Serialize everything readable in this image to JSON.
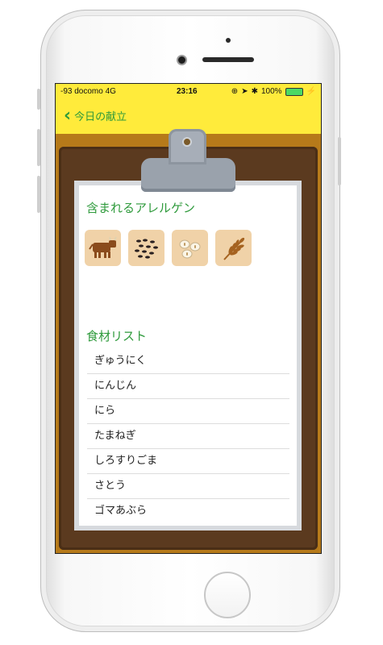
{
  "statusbar": {
    "carrier": "-93 docomo  4G",
    "time": "23:16",
    "battery": "100%"
  },
  "navbar": {
    "back_label": "今日の献立"
  },
  "allergens": {
    "title": "含まれるアレルゲン",
    "items": [
      {
        "icon": "cow-icon"
      },
      {
        "icon": "sesame-icon"
      },
      {
        "icon": "soybean-icon"
      },
      {
        "icon": "wheat-icon"
      }
    ]
  },
  "ingredients": {
    "title": "食材リスト",
    "items": [
      "ぎゅうにく",
      "にんじん",
      "にら",
      "たまねぎ",
      "しろすりごま",
      "さとう",
      "ゴマあぶら"
    ]
  }
}
